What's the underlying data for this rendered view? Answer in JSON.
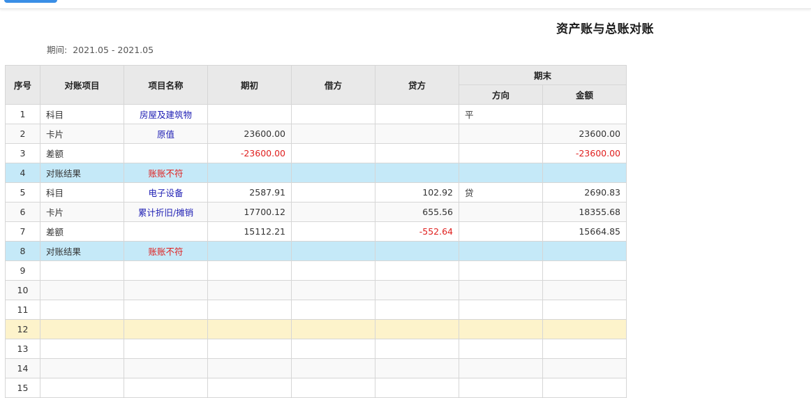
{
  "page": {
    "title": "资产账与总账对账",
    "period_label": "期间:",
    "period_value": "2021.05 - 2021.05"
  },
  "table": {
    "headers": {
      "index": "序号",
      "item": "对账项目",
      "name": "项目名称",
      "opening": "期初",
      "debit": "借方",
      "credit": "贷方",
      "closing": "期末",
      "direction": "方向",
      "amount": "金额"
    },
    "rows": [
      {
        "index": "1",
        "item": "科目",
        "name": "房屋及建筑物",
        "opening": "",
        "debit": "",
        "credit": "",
        "direction": "平",
        "amount": ""
      },
      {
        "index": "2",
        "item": "卡片",
        "name": "原值",
        "opening": "23600.00",
        "debit": "",
        "credit": "",
        "direction": "",
        "amount": "23600.00"
      },
      {
        "index": "3",
        "item": "差额",
        "name": "",
        "opening": "-23600.00",
        "debit": "",
        "credit": "",
        "direction": "",
        "amount": "-23600.00"
      },
      {
        "index": "4",
        "item": "对账结果",
        "name": "账账不符",
        "opening": "",
        "debit": "",
        "credit": "",
        "direction": "",
        "amount": ""
      },
      {
        "index": "5",
        "item": "科目",
        "name": "电子设备",
        "opening": "2587.91",
        "debit": "",
        "credit": "102.92",
        "direction": "贷",
        "amount": "2690.83"
      },
      {
        "index": "6",
        "item": "卡片",
        "name": "累计折旧/摊销",
        "opening": "17700.12",
        "debit": "",
        "credit": "655.56",
        "direction": "",
        "amount": "18355.68"
      },
      {
        "index": "7",
        "item": "差额",
        "name": "",
        "opening": "15112.21",
        "debit": "",
        "credit": "-552.64",
        "direction": "",
        "amount": "15664.85"
      },
      {
        "index": "8",
        "item": "对账结果",
        "name": "账账不符",
        "opening": "",
        "debit": "",
        "credit": "",
        "direction": "",
        "amount": ""
      },
      {
        "index": "9",
        "item": "",
        "name": "",
        "opening": "",
        "debit": "",
        "credit": "",
        "direction": "",
        "amount": ""
      },
      {
        "index": "10",
        "item": "",
        "name": "",
        "opening": "",
        "debit": "",
        "credit": "",
        "direction": "",
        "amount": ""
      },
      {
        "index": "11",
        "item": "",
        "name": "",
        "opening": "",
        "debit": "",
        "credit": "",
        "direction": "",
        "amount": ""
      },
      {
        "index": "12",
        "item": "",
        "name": "",
        "opening": "",
        "debit": "",
        "credit": "",
        "direction": "",
        "amount": ""
      },
      {
        "index": "13",
        "item": "",
        "name": "",
        "opening": "",
        "debit": "",
        "credit": "",
        "direction": "",
        "amount": ""
      },
      {
        "index": "14",
        "item": "",
        "name": "",
        "opening": "",
        "debit": "",
        "credit": "",
        "direction": "",
        "amount": ""
      },
      {
        "index": "15",
        "item": "",
        "name": "",
        "opening": "",
        "debit": "",
        "credit": "",
        "direction": "",
        "amount": ""
      }
    ]
  },
  "colors": {
    "result_row": "#c5e9f8",
    "selected_row": "#fdf3cb",
    "mismatch_text": "#e0201f",
    "name_link": "#1f1fb4"
  }
}
